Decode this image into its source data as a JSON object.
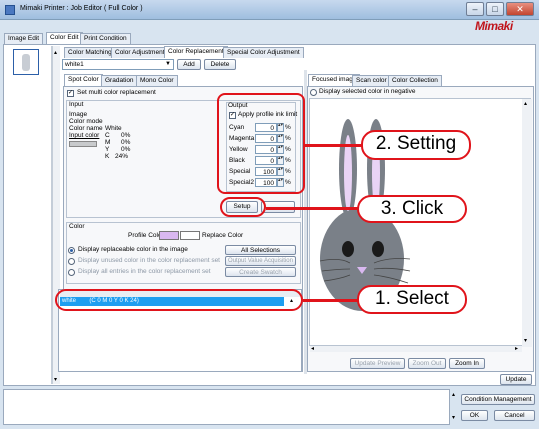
{
  "window": {
    "title": "Mimaki Printer : Job Editor ( Full Color )",
    "logo": "Mimaki"
  },
  "main_tabs": [
    "Image Edit",
    "Color Edit",
    "Print Condition"
  ],
  "sub_tabs": [
    "Color Matching",
    "Color Adjustment",
    "Color Replacement",
    "Special Color Adjustment"
  ],
  "replacement": {
    "selected": "white1",
    "add_label": "Add",
    "delete_label": "Delete"
  },
  "inner_tabs": [
    "Spot Color",
    "Gradation",
    "Mono Color"
  ],
  "multi_color_label": "Set multi color replacement",
  "input": {
    "heading": "Input",
    "image_label": "Image",
    "color_mode_label": "Color mode",
    "color_name_label": "Color name",
    "color_name": "White",
    "input_color_label": "Input color",
    "cmyk": [
      {
        "k": "C",
        "v": "0%"
      },
      {
        "k": "M",
        "v": "0%"
      },
      {
        "k": "Y",
        "v": "0%"
      },
      {
        "k": "K",
        "v": "24%"
      }
    ]
  },
  "output": {
    "heading": "Output",
    "limit_label": "Apply profile ink limit",
    "rows": [
      {
        "name": "Cyan",
        "value": "0",
        "unit": "%"
      },
      {
        "name": "Magenta",
        "value": "0",
        "unit": "%"
      },
      {
        "name": "Yellow",
        "value": "0",
        "unit": "%"
      },
      {
        "name": "Black",
        "value": "0",
        "unit": "%"
      },
      {
        "name": "Special",
        "value": "100",
        "unit": "%"
      },
      {
        "name": "Special2",
        "value": "100",
        "unit": "%"
      }
    ],
    "setup_label": "Setup"
  },
  "color_section": {
    "heading": "Color",
    "profile_color_label": "Profile Color",
    "replace_color_label": "Replace Color",
    "radios": [
      "Display replaceable color in the image",
      "Display unused color in the color replacement set",
      "Display all entries in the color replacement set"
    ],
    "buttons": [
      "All Selections",
      "Output Value Acquisition",
      "Create Swatch"
    ]
  },
  "list": {
    "row_text": "white        (C 0 M 0 Y 0 K 24)"
  },
  "preview": {
    "tabs": [
      "Focused image",
      "Scan color",
      "Color Collection"
    ],
    "negative_label": "Display selected color in negative",
    "buttons": [
      "Update Preview",
      "Zoom Out",
      "Zoom In"
    ],
    "update_label": "Update"
  },
  "footer": {
    "condition_label": "Condition Management",
    "ok_label": "OK",
    "cancel_label": "Cancel"
  },
  "callouts": [
    "2. Setting",
    "3. Click",
    "1. Select"
  ],
  "colors": {
    "accent_red": "#e0141b",
    "selection_blue": "#1e9ef0",
    "profile_swatch": "#d9b8f0"
  }
}
